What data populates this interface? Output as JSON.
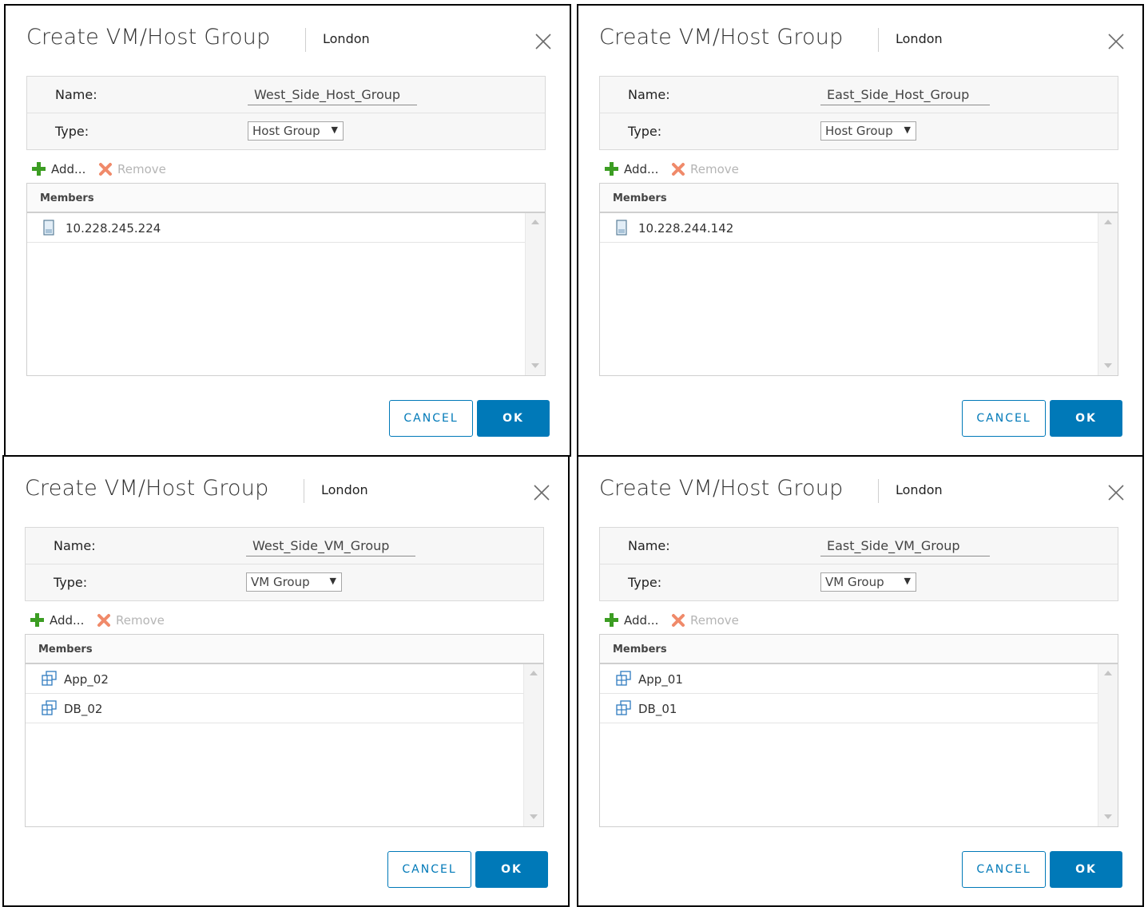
{
  "dialogs": [
    {
      "title": "Create VM/Host Group",
      "context": "London",
      "name_label": "Name:",
      "name_value": "West_Side_Host_Group",
      "type_label": "Type:",
      "type_value": "Host Group",
      "add_label": "Add...",
      "remove_label": "Remove",
      "members_header": "Members",
      "member_icon": "host-icon",
      "members": [
        "10.228.245.224"
      ],
      "cancel_label": "CANCEL",
      "ok_label": "OK"
    },
    {
      "title": "Create VM/Host Group",
      "context": "London",
      "name_label": "Name:",
      "name_value": "East_Side_Host_Group",
      "type_label": "Type:",
      "type_value": "Host Group",
      "add_label": "Add...",
      "remove_label": "Remove",
      "members_header": "Members",
      "member_icon": "host-icon",
      "members": [
        "10.228.244.142"
      ],
      "cancel_label": "CANCEL",
      "ok_label": "OK"
    },
    {
      "title": "Create VM/Host Group",
      "context": "London",
      "name_label": "Name:",
      "name_value": "West_Side_VM_Group",
      "type_label": "Type:",
      "type_value": "VM Group",
      "add_label": "Add...",
      "remove_label": "Remove",
      "members_header": "Members",
      "member_icon": "vm-icon",
      "members": [
        "App_02",
        "DB_02"
      ],
      "cancel_label": "CANCEL",
      "ok_label": "OK"
    },
    {
      "title": "Create VM/Host Group",
      "context": "London",
      "name_label": "Name:",
      "name_value": "East_Side_VM_Group",
      "type_label": "Type:",
      "type_value": "VM Group",
      "add_label": "Add...",
      "remove_label": "Remove",
      "members_header": "Members",
      "member_icon": "vm-icon",
      "members": [
        "App_01",
        "DB_01"
      ],
      "cancel_label": "CANCEL",
      "ok_label": "OK"
    }
  ],
  "colors": {
    "accent": "#0079b8",
    "add_green": "#3c9d23",
    "remove_red": "#e8603c"
  }
}
